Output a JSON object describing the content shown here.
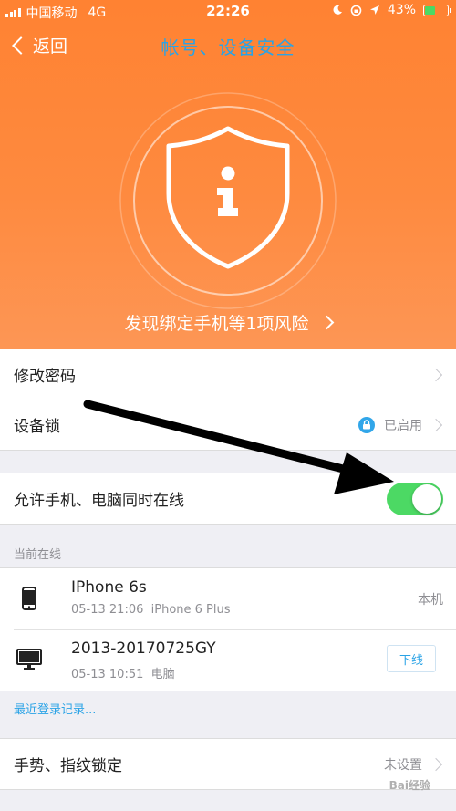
{
  "status_bar": {
    "carrier": "中国移动",
    "network": "4G",
    "time": "22:26",
    "battery_percent": "43%",
    "battery_level": 0.43
  },
  "nav": {
    "back_label": "返回",
    "title": "帐号、设备安全"
  },
  "header": {
    "risk_text": "发现绑定手机等1项风险"
  },
  "security_items": [
    {
      "label": "修改密码",
      "value": ""
    },
    {
      "label": "设备锁",
      "value": "已启用"
    }
  ],
  "online_toggle": {
    "label": "允许手机、电脑同时在线",
    "enabled": true
  },
  "online_section": {
    "title": "当前在线",
    "devices": [
      {
        "name": "IPhone 6s",
        "date": "05-13 21:06",
        "model": "iPhone 6 Plus",
        "status": "本机"
      },
      {
        "name": "2013-20170725GY",
        "date": "05-13 10:51",
        "model": "电脑",
        "action": "下线"
      }
    ]
  },
  "recent_login": "最近登录记录...",
  "lock_item": {
    "label": "手势、指纹锁定",
    "value": "未设置"
  },
  "watermark": "Bai经验",
  "colors": {
    "header_orange": "#ff8232",
    "accent_blue": "#2aa3e6",
    "toggle_green": "#4cd964"
  }
}
